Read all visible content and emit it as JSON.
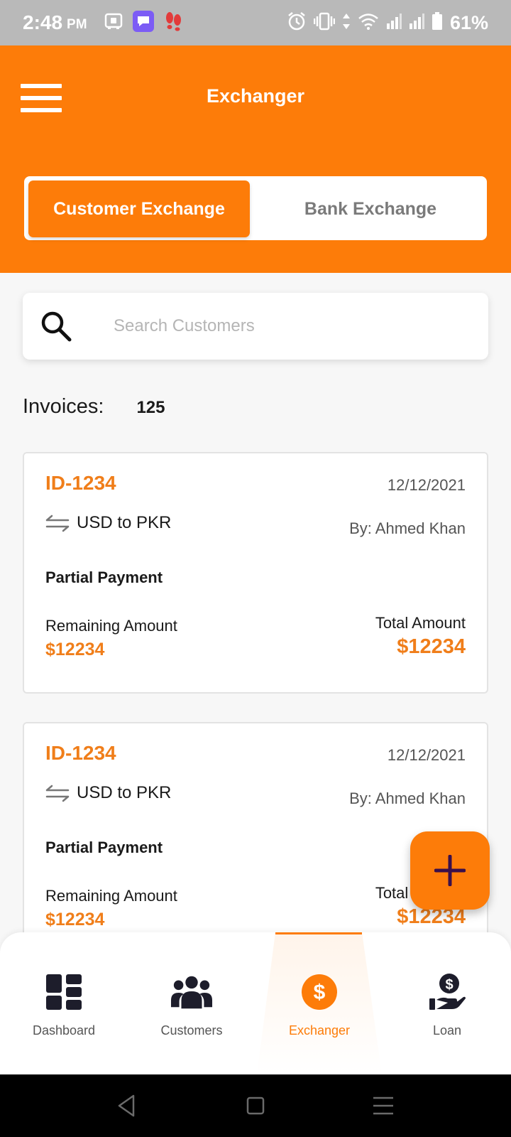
{
  "status_bar": {
    "time": "2:48",
    "ampm": "PM",
    "battery": "61%"
  },
  "header": {
    "title": "Exchanger",
    "tabs": [
      {
        "label": "Customer Exchange",
        "active": true
      },
      {
        "label": "Bank Exchange",
        "active": false
      }
    ]
  },
  "search": {
    "placeholder": "Search Customers",
    "value": ""
  },
  "invoices": {
    "label": "Invoices:",
    "count": "125"
  },
  "cards": [
    {
      "id": "ID-1234",
      "date": "12/12/2021",
      "pair": "USD to PKR",
      "by": "By: Ahmed Khan",
      "status": "Partial Payment",
      "remaining_label": "Remaining Amount",
      "remaining_value": "$12234",
      "total_label": "Total Amount",
      "total_value": "$12234"
    },
    {
      "id": "ID-1234",
      "date": "12/12/2021",
      "pair": "USD to PKR",
      "by": "By: Ahmed Khan",
      "status": "Partial Payment",
      "remaining_label": "Remaining Amount",
      "remaining_value": "$12234",
      "total_label": "Total Amount",
      "total_value": "$12234"
    }
  ],
  "bottom_nav": {
    "items": [
      {
        "label": "Dashboard",
        "icon": "dashboard-icon",
        "active": false
      },
      {
        "label": "Customers",
        "icon": "customers-icon",
        "active": false
      },
      {
        "label": "Exchanger",
        "icon": "dollar-icon",
        "active": true
      },
      {
        "label": "Loan",
        "icon": "loan-icon",
        "active": false
      }
    ]
  },
  "colors": {
    "accent": "#fd7c09",
    "amount": "#f07e1a",
    "status_bar": "#b9b9b9"
  }
}
